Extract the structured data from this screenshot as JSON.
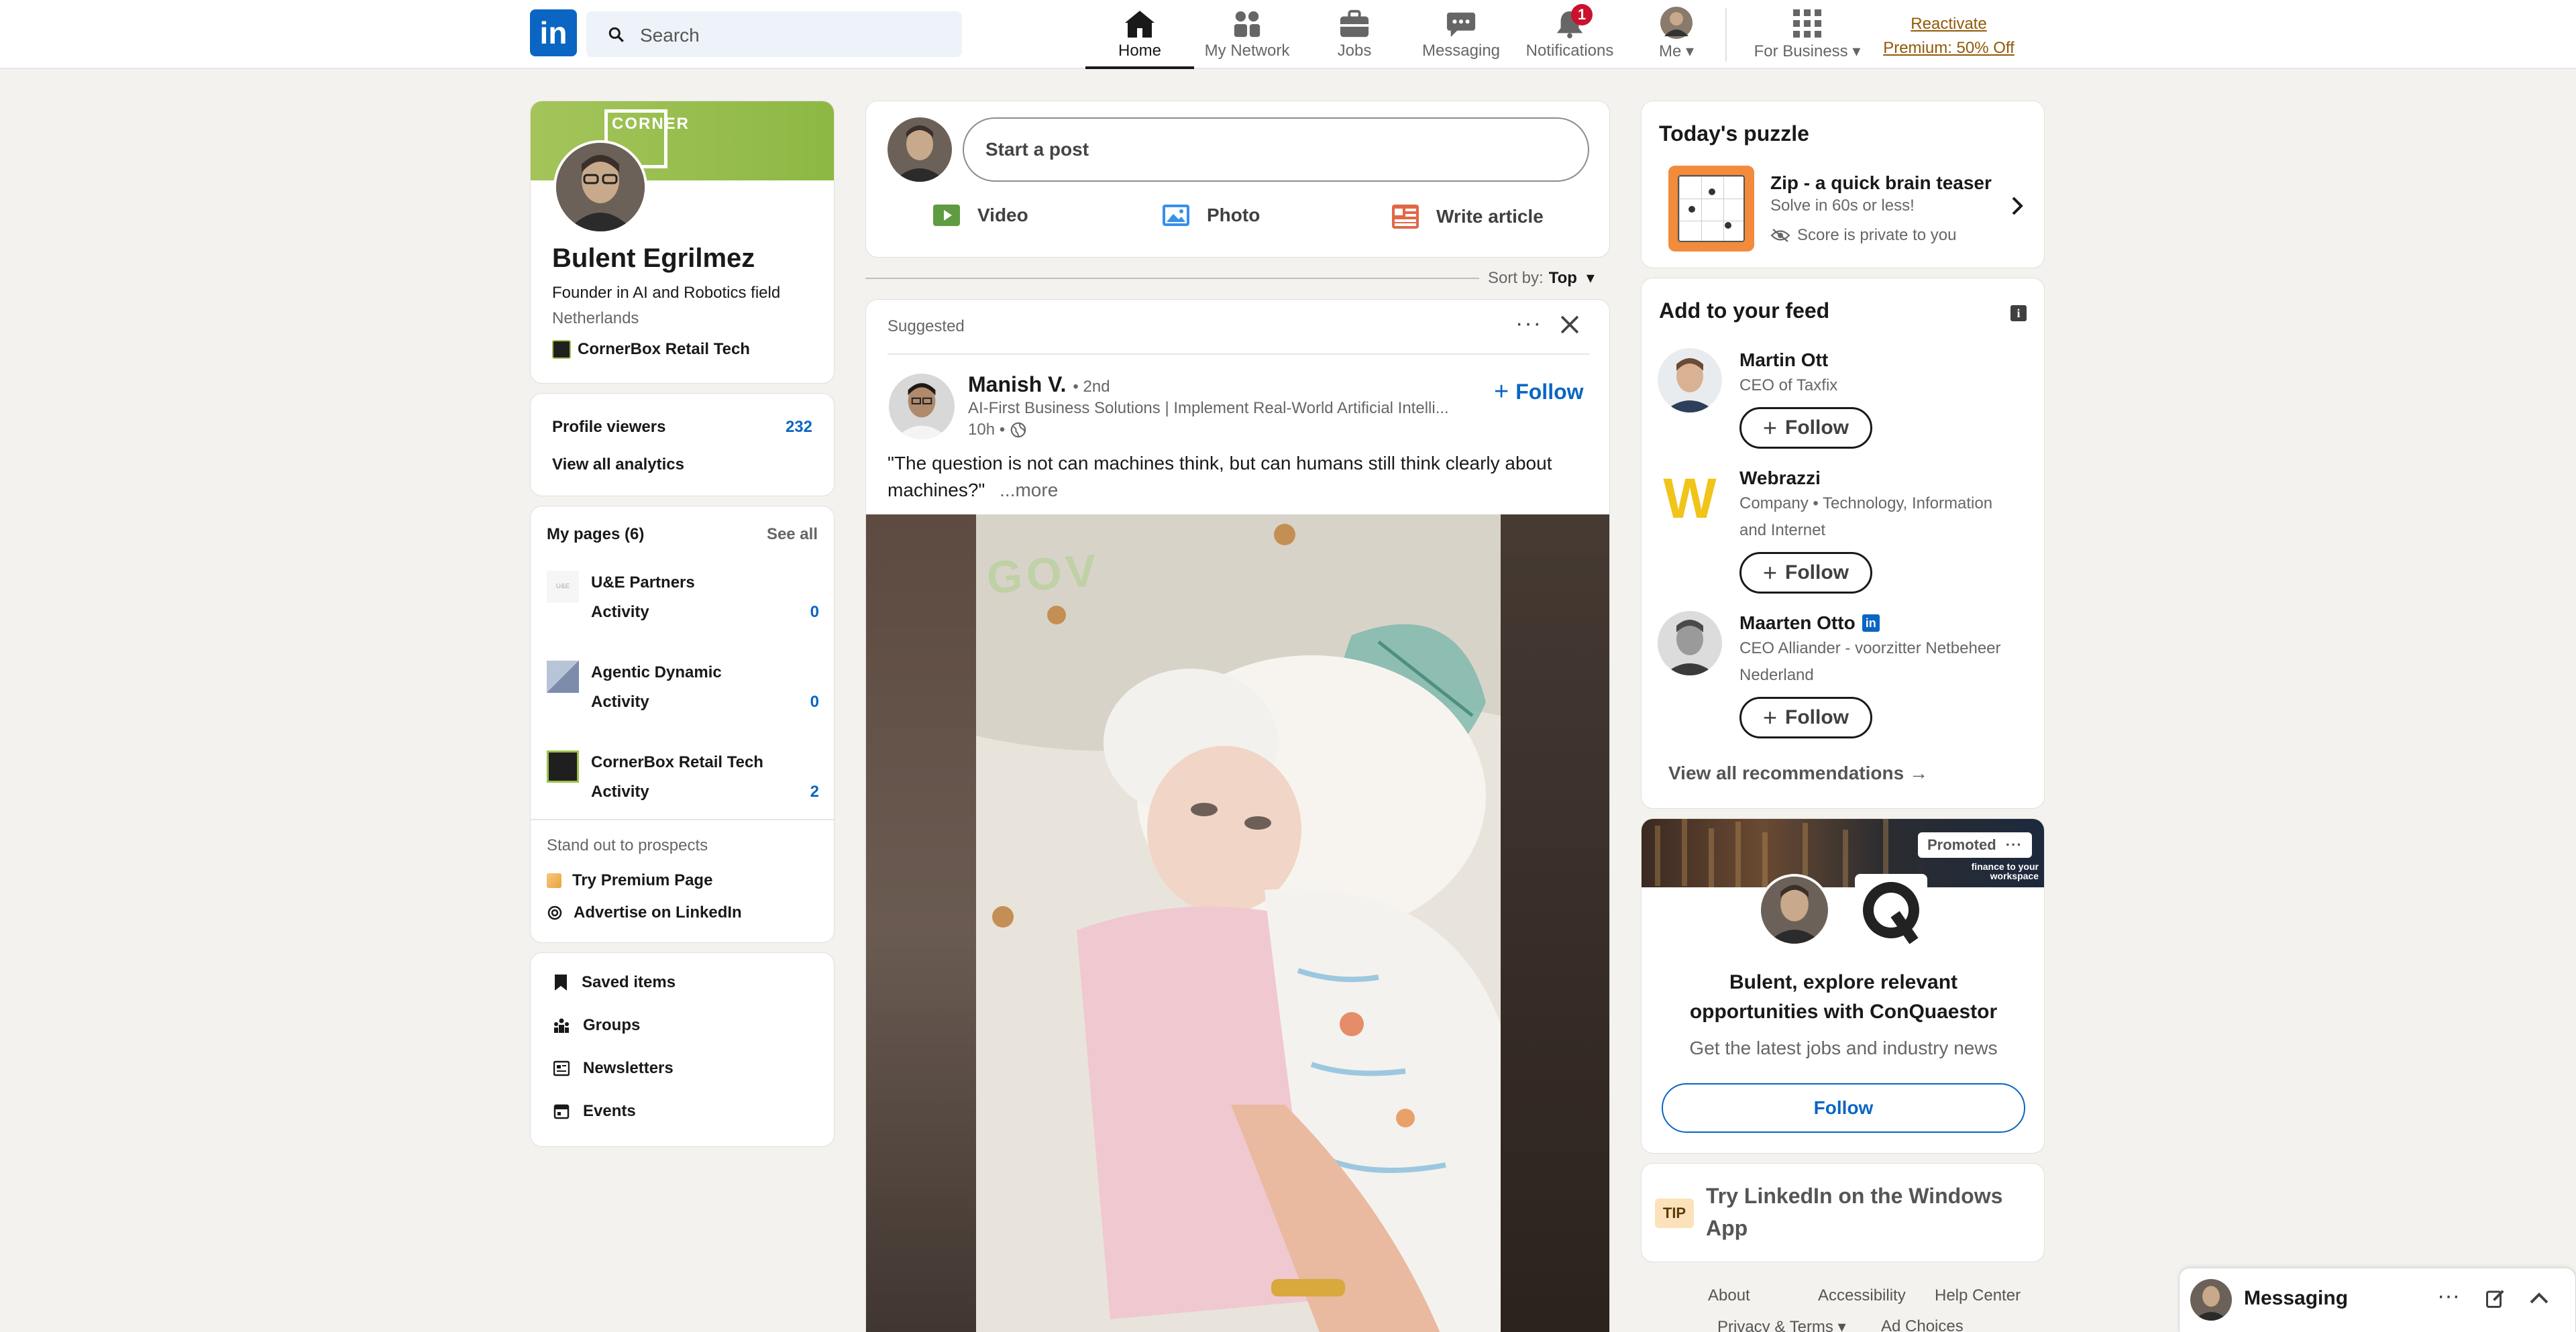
{
  "nav": {
    "search_placeholder": "Search",
    "home": "Home",
    "network": "My Network",
    "jobs": "Jobs",
    "messaging": "Messaging",
    "notifications": "Notifications",
    "notif_count": "1",
    "me": "Me",
    "business": "For Business",
    "premium_line1": "Reactivate",
    "premium_line2": "Premium: 50% Off"
  },
  "profile": {
    "cover_text": "CORNER",
    "name": "Bulent Egrilmez",
    "headline": "Founder in AI and Robotics field",
    "location": "Netherlands",
    "company": "CornerBox Retail Tech",
    "viewers_label": "Profile viewers",
    "viewers_count": "232",
    "analytics_link": "View all analytics"
  },
  "pages": {
    "title": "My pages (6)",
    "see_all": "See all",
    "items": [
      {
        "name": "U&E Partners",
        "activity_label": "Activity",
        "count": "0"
      },
      {
        "name": "Agentic Dynamic",
        "activity_label": "Activity",
        "count": "0"
      },
      {
        "name": "CornerBox Retail Tech",
        "activity_label": "Activity",
        "count": "2"
      }
    ],
    "standout": "Stand out to prospects",
    "premium_page": "Try Premium Page",
    "advertise": "Advertise on LinkedIn"
  },
  "shortcuts": [
    "Saved items",
    "Groups",
    "Newsletters",
    "Events"
  ],
  "composer": {
    "placeholder": "Start a post",
    "video": "Video",
    "photo": "Photo",
    "article": "Write article"
  },
  "sort": {
    "label": "Sort by:",
    "value": "Top"
  },
  "post": {
    "suggested": "Suggested",
    "author": "Manish V.",
    "degree": "• 2nd",
    "subtitle": "AI-First Business Solutions | Implement Real-World Artificial Intelli...",
    "time": "10h •",
    "follow": "Follow",
    "text": "\"The question is not can machines think, but can humans still think clearly about machines?\"",
    "more": "...more",
    "image_overlay": "GOV"
  },
  "puzzle": {
    "title": "Today's puzzle",
    "name": "Zip - a quick brain teaser",
    "sub": "Solve in 60s or less!",
    "private": "Score is private to you"
  },
  "feed": {
    "title": "Add to your feed",
    "items": [
      {
        "name": "Martin Ott",
        "desc": "CEO of Taxfix",
        "desc2": "",
        "follow": "Follow"
      },
      {
        "name": "Webrazzi",
        "desc": "Company • Technology, Information",
        "desc2": "and Internet",
        "follow": "Follow"
      },
      {
        "name": "Maarten Otto",
        "desc": "CEO Alliander - voorzitter Netbeheer",
        "desc2": "Nederland",
        "follow": "Follow"
      }
    ],
    "view_all": "View all recommendations →"
  },
  "promo": {
    "badge": "Promoted",
    "banner_text_1": "finance to your",
    "banner_text_2": "workspace",
    "headline": "Bulent, explore relevant opportunities with ConQuaestor",
    "sub": "Get the latest jobs and industry news",
    "follow": "Follow"
  },
  "tip": {
    "badge": "TIP",
    "text": "Try LinkedIn on the Windows App"
  },
  "footer": {
    "about": "About",
    "accessibility": "Accessibility",
    "help": "Help Center",
    "privacy": "Privacy & Terms",
    "ads": "Ad Choices"
  },
  "messaging_bar": {
    "label": "Messaging"
  },
  "colors": {
    "brand": "#0a66c2",
    "notif": "#cb112d",
    "premium": "#915907"
  }
}
